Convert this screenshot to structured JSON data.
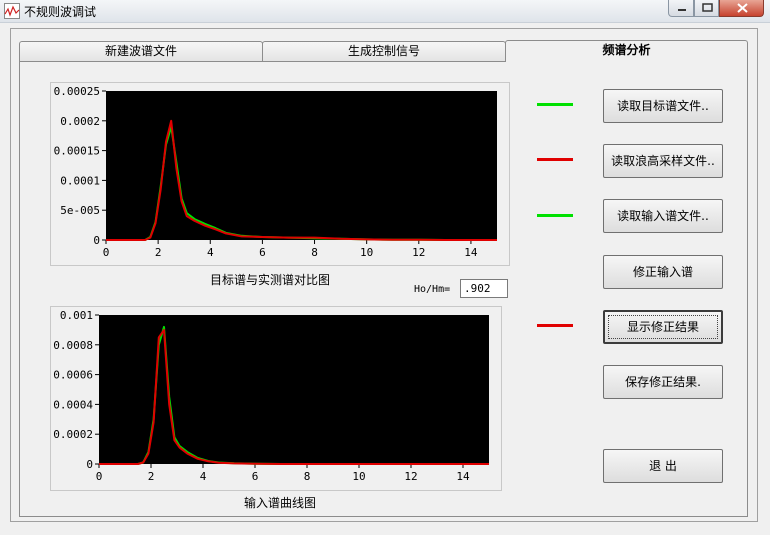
{
  "window": {
    "title": "不规则波调试"
  },
  "tabs": [
    {
      "label": "新建波谱文件",
      "active": false
    },
    {
      "label": "生成控制信号",
      "active": false
    },
    {
      "label": "频谱分析",
      "active": true
    }
  ],
  "ratio": {
    "label": "Ho/Hm=",
    "value": ".902"
  },
  "buttons": {
    "read_target": "读取目标谱文件..",
    "read_wave": "读取浪高采样文件..",
    "read_input": "读取输入谱文件..",
    "correct_input": "修正输入谱",
    "show_result": "显示修正结果",
    "save_result": "保存修正结果.",
    "exit": "退 出"
  },
  "legend_colors": {
    "read_target": "#00e000",
    "read_wave": "#e00000",
    "read_input": "#00e000",
    "show_result": "#e00000"
  },
  "chart_data": [
    {
      "type": "line",
      "title": "目标谱与实测谱对比图",
      "xlim": [
        0,
        15
      ],
      "ylim": [
        0,
        0.00025
      ],
      "x_ticks": [
        "0",
        "2",
        "4",
        "6",
        "8",
        "10",
        "12",
        "14"
      ],
      "y_ticks": [
        "0",
        "5e-005",
        "0.0001",
        "0.00015",
        "0.0002",
        "0.00025"
      ],
      "series": [
        {
          "color": "#00e000",
          "x": [
            0,
            1.5,
            1.7,
            1.9,
            2.1,
            2.3,
            2.5,
            2.7,
            2.9,
            3.1,
            3.4,
            3.8,
            4.2,
            4.6,
            5.2,
            6,
            7,
            8,
            9,
            10,
            11,
            12,
            13,
            14,
            15
          ],
          "y": [
            0,
            0,
            5e-06,
            3e-05,
            9e-05,
            0.00016,
            0.00019,
            0.00013,
            7e-05,
            4.5e-05,
            3.5e-05,
            2.7e-05,
            2e-05,
            1.2e-05,
            7e-06,
            5e-06,
            4e-06,
            3e-06,
            2e-06,
            1e-06,
            5e-07,
            3e-07,
            0,
            0,
            0
          ]
        },
        {
          "color": "#e00000",
          "x": [
            0,
            1.5,
            1.7,
            1.9,
            2.1,
            2.3,
            2.5,
            2.7,
            2.9,
            3.1,
            3.4,
            3.8,
            4.2,
            4.6,
            5.2,
            6,
            7,
            8,
            9,
            10,
            11,
            12,
            13,
            14,
            15
          ],
          "y": [
            0,
            0,
            4e-06,
            2.8e-05,
            8.5e-05,
            0.000165,
            0.0002,
            0.00012,
            6.5e-05,
            4e-05,
            3.2e-05,
            2.4e-05,
            1.8e-05,
            1.1e-05,
            6e-06,
            5e-06,
            4e-06,
            4e-06,
            2e-06,
            1e-06,
            5e-07,
            3e-07,
            0,
            0,
            0
          ]
        }
      ]
    },
    {
      "type": "line",
      "title": "输入谱曲线图",
      "xlim": [
        0,
        15
      ],
      "ylim": [
        0,
        0.001
      ],
      "x_ticks": [
        "0",
        "2",
        "4",
        "6",
        "8",
        "10",
        "12",
        "14"
      ],
      "y_ticks": [
        "0",
        "0.0002",
        "0.0004",
        "0.0006",
        "0.0008",
        "0.001"
      ],
      "series": [
        {
          "color": "#00e000",
          "x": [
            0,
            1.5,
            1.7,
            1.9,
            2.1,
            2.3,
            2.5,
            2.7,
            2.9,
            3.1,
            3.4,
            3.8,
            4.2,
            4.6,
            5.2,
            6,
            7,
            8,
            15
          ],
          "y": [
            0,
            0,
            1e-05,
            8e-05,
            0.0003,
            0.0008,
            0.00092,
            0.00045,
            0.00018,
            0.00012,
            8e-05,
            4e-05,
            2e-05,
            1e-05,
            5e-06,
            2e-06,
            0,
            0,
            0
          ]
        },
        {
          "color": "#e00000",
          "x": [
            0,
            1.5,
            1.7,
            1.9,
            2.1,
            2.3,
            2.5,
            2.7,
            2.9,
            3.1,
            3.4,
            3.8,
            4.2,
            4.6,
            5.2,
            6,
            7,
            8,
            15
          ],
          "y": [
            0,
            0,
            1e-05,
            7e-05,
            0.00028,
            0.00085,
            0.0009,
            0.0004,
            0.00016,
            0.00011,
            7e-05,
            3.5e-05,
            1.8e-05,
            9e-06,
            4e-06,
            2e-06,
            0,
            0,
            0
          ]
        }
      ]
    }
  ]
}
